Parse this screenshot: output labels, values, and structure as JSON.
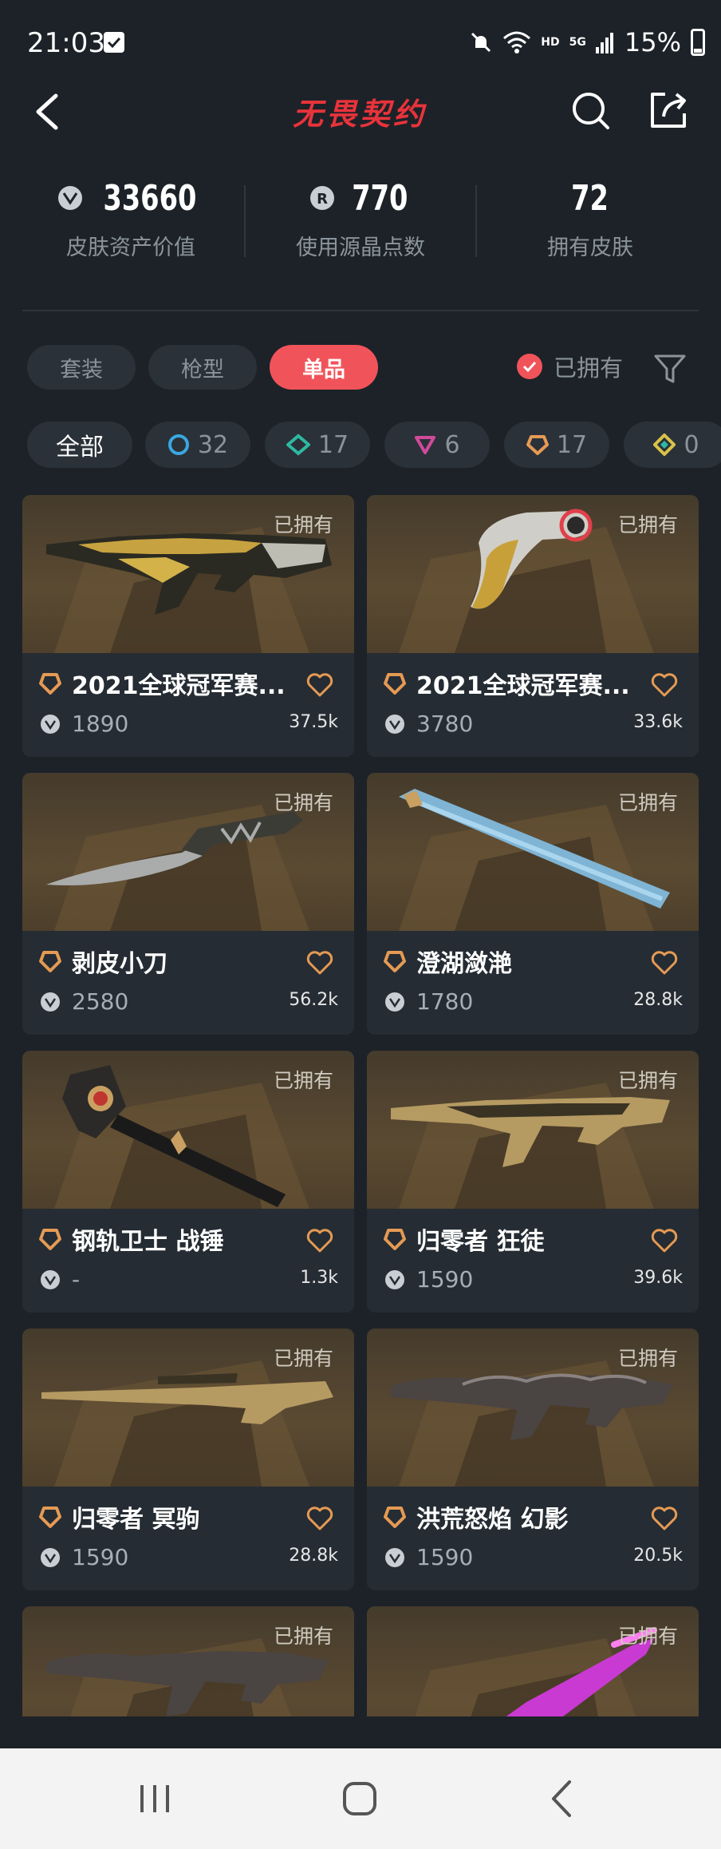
{
  "status_bar": {
    "time": "21:03",
    "network": "HD",
    "signal": "5G",
    "battery": "15%"
  },
  "header": {
    "title": "无畏契约"
  },
  "stats": [
    {
      "value": "33660",
      "label": "皮肤资产价值",
      "icon": "vp-icon"
    },
    {
      "value": "770",
      "label": "使用源晶点数",
      "icon": "radianite-icon"
    },
    {
      "value": "72",
      "label": "拥有皮肤",
      "icon": ""
    }
  ],
  "tabs": [
    {
      "label": "套装"
    },
    {
      "label": "枪型"
    },
    {
      "label": "单品",
      "active": true
    }
  ],
  "owned_filter": {
    "label": "已拥有",
    "checked": true
  },
  "rarity_chips": [
    {
      "label": "全部"
    },
    {
      "count": "32",
      "color": "#3aa7e0"
    },
    {
      "count": "17",
      "color": "#2fb8a3"
    },
    {
      "count": "6",
      "color": "#d04a9c"
    },
    {
      "count": "17",
      "color": "#e59a54"
    },
    {
      "count": "0",
      "color": "#d9c24a"
    }
  ],
  "cards": [
    {
      "owned": "已拥有",
      "name": "2021全球冠军赛...",
      "price": "1890",
      "likes": "37.5k",
      "tier_color": "#e59a54"
    },
    {
      "owned": "已拥有",
      "name": "2021全球冠军赛...",
      "price": "3780",
      "likes": "33.6k",
      "tier_color": "#e59a54"
    },
    {
      "owned": "已拥有",
      "name": "剥皮小刀",
      "price": "2580",
      "likes": "56.2k",
      "tier_color": "#e59a54"
    },
    {
      "owned": "已拥有",
      "name": "澄湖潋滟",
      "price": "1780",
      "likes": "28.8k",
      "tier_color": "#e59a54"
    },
    {
      "owned": "已拥有",
      "name": "钢轨卫士 战锤",
      "price": "-",
      "likes": "1.3k",
      "tier_color": "#e59a54"
    },
    {
      "owned": "已拥有",
      "name": "归零者 狂徒",
      "price": "1590",
      "likes": "39.6k",
      "tier_color": "#e59a54"
    },
    {
      "owned": "已拥有",
      "name": "归零者 冥驹",
      "price": "1590",
      "likes": "28.8k",
      "tier_color": "#e59a54"
    },
    {
      "owned": "已拥有",
      "name": "洪荒怒焰 幻影",
      "price": "1590",
      "likes": "20.5k",
      "tier_color": "#e59a54"
    },
    {
      "owned": "已拥有"
    },
    {
      "owned": "已拥有"
    }
  ]
}
